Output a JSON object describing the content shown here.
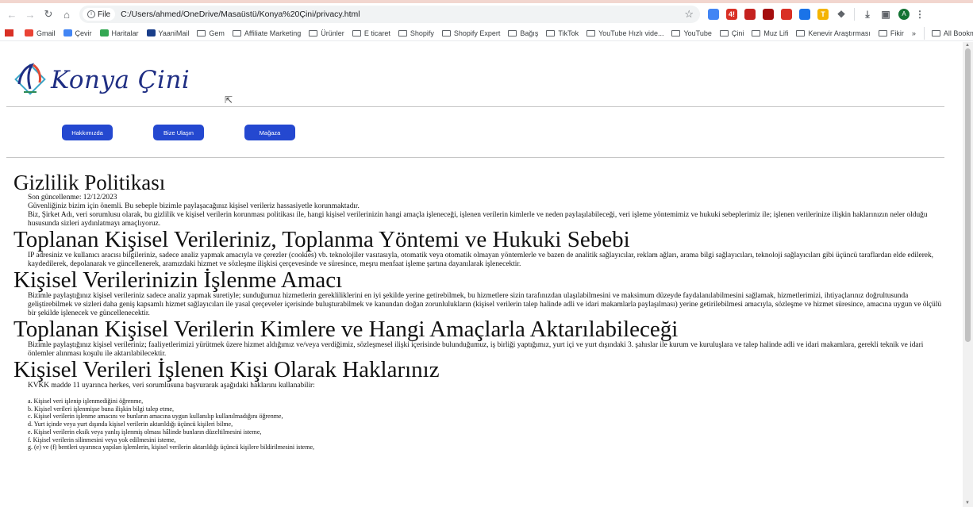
{
  "browser": {
    "url_chip": "File",
    "url": "C:/Users/ahmed/OneDrive/Masaüstü/Konya%20Çini/privacy.html",
    "profile_initial": "A",
    "extensions": [
      {
        "name": "bookmark-ext-icon",
        "text": "",
        "color": "#4285f4"
      },
      {
        "name": "pdf-ext-icon",
        "text": "4!",
        "color": "#d93025"
      },
      {
        "name": "shield-ext-icon",
        "text": "",
        "color": "#c5221f"
      },
      {
        "name": "record-ext-icon",
        "text": "",
        "color": "#a50e0e"
      },
      {
        "name": "screenshot-ext-icon",
        "text": "",
        "color": "#d93025"
      },
      {
        "name": "cloud-ext-icon",
        "text": "",
        "color": "#1a73e8"
      },
      {
        "name": "translate-ext-icon",
        "text": "T",
        "color": "#f4b400"
      }
    ]
  },
  "bookmarks": {
    "items": [
      {
        "label": "Gmail",
        "icon": "gmail-icon"
      },
      {
        "label": "Çevir",
        "icon": "translate-icon"
      },
      {
        "label": "Haritalar",
        "icon": "maps-icon"
      },
      {
        "label": "YaaniMail",
        "icon": "mail-icon"
      },
      {
        "label": "Gem",
        "icon": "folder-icon"
      },
      {
        "label": "Affiliate Marketing",
        "icon": "folder-icon"
      },
      {
        "label": "Ürünler",
        "icon": "folder-icon"
      },
      {
        "label": "E ticaret",
        "icon": "folder-icon"
      },
      {
        "label": "Shopify",
        "icon": "folder-icon"
      },
      {
        "label": "Shopify Expert",
        "icon": "folder-icon"
      },
      {
        "label": "Bağış",
        "icon": "folder-icon"
      },
      {
        "label": "TikTok",
        "icon": "folder-icon"
      },
      {
        "label": "YouTube Hızlı vide...",
        "icon": "folder-icon"
      },
      {
        "label": "YouTube",
        "icon": "folder-icon"
      },
      {
        "label": "Çini",
        "icon": "folder-icon"
      },
      {
        "label": "Muz Lifi",
        "icon": "folder-icon"
      },
      {
        "label": "Kenevir Araştırması",
        "icon": "folder-icon"
      },
      {
        "label": "Fikir",
        "icon": "folder-icon"
      }
    ],
    "more": "»",
    "all_bookmarks": "All Bookmarks"
  },
  "site": {
    "logo_text": "Konya Çini",
    "buttons": [
      "Hakkımızda",
      "Bize Ulaşın",
      "Mağaza"
    ]
  },
  "doc": {
    "title": "Gizlilik Politikası",
    "updated": "Son güncellenme: 12/12/2023",
    "intro1": "Güvenliğiniz bizim için önemli. Bu sebeple bizimle paylaşacağınız kişisel verileriz hassasiyetle korunmaktadır.",
    "intro2": "Biz, Şirket Adı, veri sorumlusu olarak, bu gizlilik ve kişisel verilerin korunması politikası ile, hangi kişisel verilerinizin hangi amaçla işleneceği, işlenen verilerin kimlerle ve neden paylaşılabileceği, veri işleme yöntemimiz ve hukuki sebeplerimiz ile; işlenen verilerinize ilişkin haklarınızın neler olduğu hususunda sizleri aydınlatmayı amaçlıyoruz.",
    "s1_title": "Toplanan Kişisel Verileriniz, Toplanma Yöntemi ve Hukuki Sebebi",
    "s1_body": "IP adresiniz ve kullanıcı aracısı bilgileriniz, sadece analiz yapmak amacıyla ve çerezler (cookies) vb. teknolojiler vasıtasıyla, otomatik veya otomatik olmayan yöntemlerle ve bazen de analitik sağlayıcılar, reklam ağları, arama bilgi sağlayıcıları, teknoloji sağlayıcıları gibi üçüncü taraflardan elde edilerek, kaydedilerek, depolanarak ve güncellenerek, aramızdaki hizmet ve sözleşme ilişkisi çerçevesinde ve süresince, meşru menfaat işleme şartına dayanılarak işlenecektir.",
    "s2_title": "Kişisel Verilerinizin İşlenme Amacı",
    "s2_body": "Bizimle paylaştığınız kişisel verileriniz sadece analiz yapmak suretiyle; sunduğumuz hizmetlerin gerekliliklerini en iyi şekilde yerine getirebilmek, bu hizmetlere sizin tarafınızdan ulaşılabilmesini ve maksimum düzeyde faydalanılabilmesini sağlamak, hizmetlerimizi, ihtiyaçlarınız doğrultusunda geliştirebilmek ve sizleri daha geniş kapsamlı hizmet sağlayıcıları ile yasal çerçeveler içerisinde buluşturabilmek ve kanundan doğan zorunlulukların (kişisel verilerin talep halinde adli ve idari makamlarla paylaşılması) yerine getirilebilmesi amacıyla, sözleşme ve hizmet süresince, amacına uygun ve ölçülü bir şekilde işlenecek ve güncellenecektir.",
    "s3_title": "Toplanan Kişisel Verilerin Kimlere ve Hangi Amaçlarla Aktarılabileceği",
    "s3_body": "Bizimle paylaştığınız kişisel verileriniz; faaliyetlerimizi yürütmek üzere hizmet aldığımız ve/veya verdiğimiz, sözleşmesel ilişki içerisinde bulunduğumuz, iş birliği yaptığımız, yurt içi ve yurt dışındaki 3. şahıslar ile kurum ve kuruluşlara ve talep halinde adli ve idari makamlara, gerekli teknik ve idari önlemler alınması koşulu ile aktarılabilecektir.",
    "s4_title": "Kişisel Verileri İşlenen Kişi Olarak Haklarınız",
    "s4_body": "KVKK madde 11 uyarınca herkes, veri sorumlusuna başvurarak aşağıdaki haklarını kullanabilir:",
    "rights": [
      "a. Kişisel veri işlenip işlenmediğini öğrenme,",
      "b. Kişisel verileri işlenmişse buna ilişkin bilgi talep etme,",
      "c. Kişisel verilerin işlenme amacını ve bunların amacına uygun kullanılıp kullanılmadığını öğrenme,",
      "d. Yurt içinde veya yurt dışında kişisel verilerin aktarıldığı üçüncü kişileri bilme,",
      "e. Kişisel verilerin eksik veya yanlış işlenmiş olması hâlinde bunların düzeltilmesini isteme,",
      "f. Kişisel verilerin silinmesini veya yok edilmesini isteme,",
      "g. (e) ve (f) bentleri uyarınca yapılan işlemlerin, kişisel verilerin aktarıldığı üçüncü kişilere bildirilmesini isteme,"
    ]
  },
  "colors": {
    "brand_blue": "#1f2e83",
    "button_blue": "#2448d0"
  }
}
